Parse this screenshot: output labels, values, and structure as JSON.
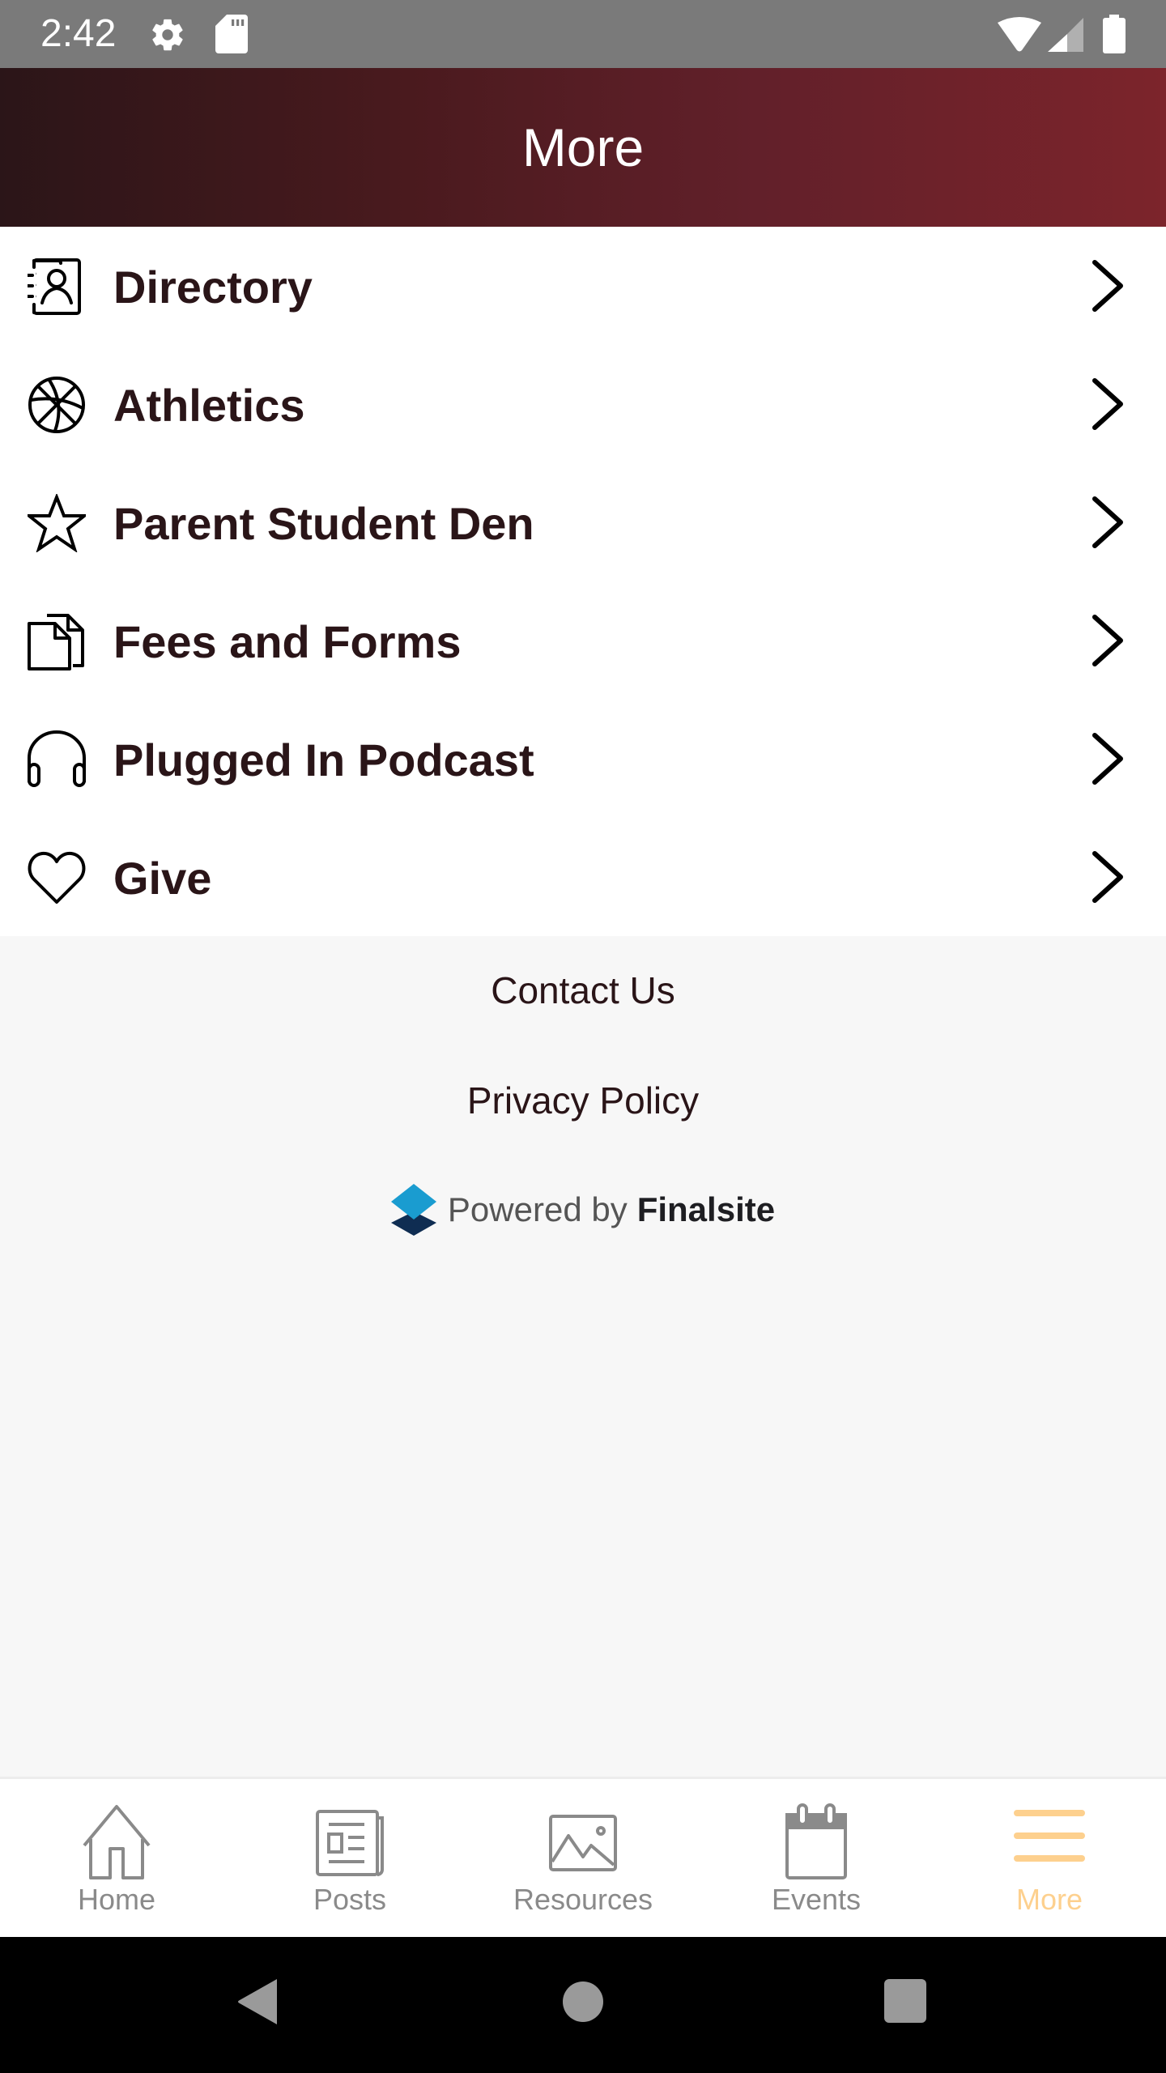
{
  "status_bar": {
    "time": "2:42",
    "left_icons": [
      "settings-icon",
      "sd-card-icon"
    ],
    "right_icons": [
      "wifi-icon",
      "cell-signal-icon",
      "battery-icon"
    ]
  },
  "header": {
    "title": "More",
    "gradient_start": "#2b1518",
    "gradient_end": "#7c242b"
  },
  "menu": {
    "items": [
      {
        "label": "Directory",
        "icon": "contact-book-icon"
      },
      {
        "label": "Athletics",
        "icon": "basketball-icon"
      },
      {
        "label": "Parent Student Den",
        "icon": "star-icon"
      },
      {
        "label": "Fees and Forms",
        "icon": "documents-icon"
      },
      {
        "label": "Plugged In Podcast",
        "icon": "headphones-icon"
      },
      {
        "label": "Give",
        "icon": "heart-icon"
      }
    ],
    "text_color": "#2a1518"
  },
  "footer": {
    "contact_label": "Contact Us",
    "privacy_label": "Privacy Policy",
    "powered_by": "Powered by",
    "brand": "Finalsite"
  },
  "tab_bar": {
    "tabs": [
      {
        "label": "Home",
        "icon": "home-icon",
        "active": false
      },
      {
        "label": "Posts",
        "icon": "newspaper-icon",
        "active": false
      },
      {
        "label": "Resources",
        "icon": "image-icon",
        "active": false
      },
      {
        "label": "Events",
        "icon": "calendar-icon",
        "active": false
      },
      {
        "label": "More",
        "icon": "menu-icon",
        "active": true
      }
    ],
    "inactive_color": "#8a8a8a",
    "active_color": "#fdd08e"
  },
  "system_nav": {
    "buttons": [
      "back-icon",
      "home-circle-icon",
      "recents-icon"
    ]
  }
}
